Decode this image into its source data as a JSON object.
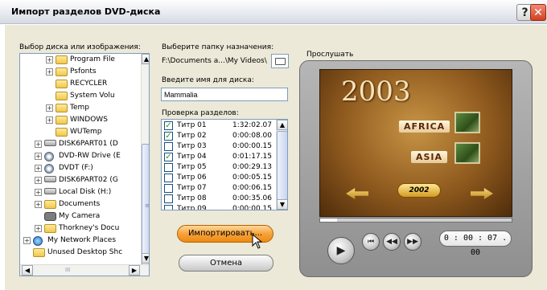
{
  "window": {
    "title": "Импорт разделов DVD-диска",
    "help_label": "?",
    "close_label": "✕"
  },
  "source": {
    "label": "Выбор диска или изображения:",
    "tree": [
      {
        "label": "Program File",
        "icon": "folder-icon",
        "expander": "+",
        "level": 3
      },
      {
        "label": "Psfonts",
        "icon": "folder-icon",
        "expander": "+",
        "level": 3
      },
      {
        "label": "RECYCLER",
        "icon": "folder-icon",
        "expander": "",
        "level": 3
      },
      {
        "label": "System Volu",
        "icon": "folder-icon",
        "expander": "",
        "level": 3
      },
      {
        "label": "Temp",
        "icon": "folder-icon",
        "expander": "+",
        "level": 3
      },
      {
        "label": "WINDOWS",
        "icon": "folder-icon",
        "expander": "+",
        "level": 3
      },
      {
        "label": "WUTemp",
        "icon": "folder-icon",
        "expander": "",
        "level": 3
      },
      {
        "label": "DISK6PART01 (D",
        "icon": "drive-icon",
        "expander": "+",
        "level": 2
      },
      {
        "label": "DVD-RW Drive (E",
        "icon": "dvd-drive-icon",
        "expander": "+",
        "level": 2
      },
      {
        "label": "DVDT (F:)",
        "icon": "dvd-drive-icon",
        "expander": "+",
        "level": 2
      },
      {
        "label": "DISK6PART02 (G",
        "icon": "drive-icon",
        "expander": "+",
        "level": 2
      },
      {
        "label": "Local Disk (H:)",
        "icon": "drive-icon",
        "expander": "+",
        "level": 2
      },
      {
        "label": "Documents",
        "icon": "folder-icon",
        "expander": "+",
        "level": 2
      },
      {
        "label": "My Camera",
        "icon": "camera-icon",
        "expander": "",
        "level": 2
      },
      {
        "label": "Thorkney's Docu",
        "icon": "folder-icon",
        "expander": "+",
        "level": 2
      },
      {
        "label": "My Network Places",
        "icon": "network-icon",
        "expander": "+",
        "level": 1
      },
      {
        "label": "Unused Desktop Shc",
        "icon": "folder-icon",
        "expander": "",
        "level": 1
      }
    ],
    "scroll_glyphs": {
      "up": "▲",
      "down": "▼",
      "left": "◀",
      "right": "▶",
      "grip": "≡",
      "hgrip": "III"
    }
  },
  "destination": {
    "label": "Выберите папку назначения:",
    "path": "F:\\Documents a...\\My Videos\\"
  },
  "disk_name": {
    "label": "Введите имя для диска:",
    "value": "Mammalia"
  },
  "chapters": {
    "label": "Проверка разделов:",
    "items": [
      {
        "name": "Титр 01",
        "duration": "1:32:02.07",
        "checked": true
      },
      {
        "name": "Титр 02",
        "duration": "0:00:08.00",
        "checked": true
      },
      {
        "name": "Титр 03",
        "duration": "0:00:00.15",
        "checked": false
      },
      {
        "name": "Титр 04",
        "duration": "0:01:17.15",
        "checked": true
      },
      {
        "name": "Титр 05",
        "duration": "0:00:29.13",
        "checked": false
      },
      {
        "name": "Титр 06",
        "duration": "0:00:05.15",
        "checked": false
      },
      {
        "name": "Титр 07",
        "duration": "0:00:06.15",
        "checked": false
      },
      {
        "name": "Титр 08",
        "duration": "0:00:35.06",
        "checked": false
      },
      {
        "name": "Титр 09",
        "duration": "0:00:00.15",
        "checked": false
      }
    ]
  },
  "buttons": {
    "import_label": "Импортировать...",
    "cancel_label": "Отмена"
  },
  "preview": {
    "label": "Прослушать",
    "menu_year": "2003",
    "menu_items": [
      "AFRICA",
      "ASIA"
    ],
    "year_badge": "2002",
    "timecode": "0 : 00 : 07 . 00",
    "progress_fraction": 0.09,
    "controls": {
      "play": "▶",
      "prev": "⏮",
      "rewind": "◀◀",
      "forward": "▶▶"
    }
  }
}
